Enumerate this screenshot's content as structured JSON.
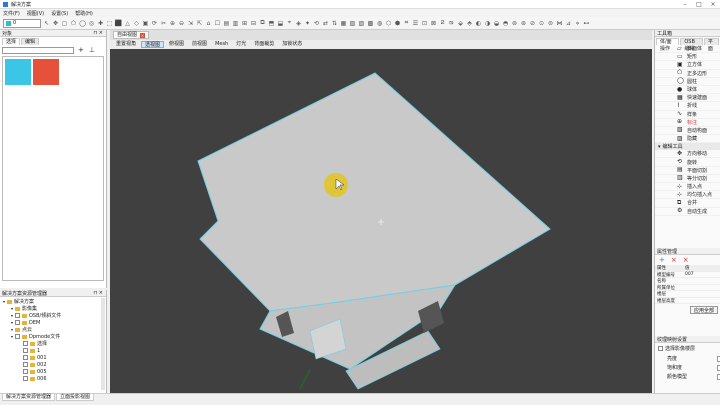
{
  "app": {
    "title": "解决方案"
  },
  "menu": [
    "文件(F)",
    "视图(V)",
    "设置(S)",
    "帮助(H)"
  ],
  "toolbar": {
    "layer_value": "0"
  },
  "layers": {
    "title": "对象",
    "tabs": [
      "选择",
      "编辑"
    ],
    "swatches": [
      "#3bc6e8",
      "#e5513a"
    ]
  },
  "solution": {
    "title": "解决方案资源管理器",
    "rows": [
      {
        "label": "解决方案",
        "indent": 0,
        "check": false
      },
      {
        "label": "影像集",
        "indent": 1,
        "check": false
      },
      {
        "label": "OSB/倾斜文件",
        "indent": 1,
        "check": true
      },
      {
        "label": "DEM",
        "indent": 1,
        "check": true
      },
      {
        "label": "点云",
        "indent": 1,
        "check": false
      },
      {
        "label": "Dpmode文件",
        "indent": 1,
        "check": true
      },
      {
        "label": "选择",
        "indent": 2,
        "check": true
      },
      {
        "label": "1",
        "indent": 2,
        "check": true
      },
      {
        "label": "001",
        "indent": 2,
        "check": true
      },
      {
        "label": "002",
        "indent": 2,
        "check": true
      },
      {
        "label": "005",
        "indent": 2,
        "check": true
      },
      {
        "label": "006",
        "indent": 2,
        "check": true
      }
    ]
  },
  "bottom_tabs": [
    "解决方案资源管理器",
    "立面投影视图"
  ],
  "document": {
    "tab_title": "自由视图",
    "view_tabs": [
      "重置视角",
      "透视图",
      "俯视图",
      "前视图",
      "Mesh",
      "灯光",
      "背面裁剪",
      "加锁状态"
    ],
    "active_view_tab": "透视图"
  },
  "tools": {
    "title": "工具箱",
    "tabs": [
      "体/面操作",
      "OSB编辑",
      "平面"
    ],
    "draw_items": [
      "多面体",
      "矩形",
      "立方体",
      "正多边形",
      "圆柱",
      "球体",
      "快速建面",
      "折线",
      "样条",
      "标注",
      "自动构面",
      "隐藏"
    ],
    "edit_section": "编辑工具",
    "edit_items": [
      "方向移动",
      "旋转",
      "平面切割",
      "等分切割",
      "插入点",
      "均匀插入点",
      "合并",
      "自动生成"
    ]
  },
  "props": {
    "title": "属性管理",
    "header": [
      "属性",
      "值"
    ],
    "rows": [
      [
        "模型编号",
        "007"
      ],
      [
        "名称",
        ""
      ],
      [
        "所属单位",
        ""
      ],
      [
        "楼层",
        ""
      ],
      [
        "楼层高度",
        ""
      ]
    ],
    "apply_btn": "应用全部"
  },
  "texture": {
    "title": "纹理映射设置",
    "check_label": "选择影像楼层",
    "fields": [
      "亮度",
      "饱和度",
      "颜色模型"
    ]
  }
}
